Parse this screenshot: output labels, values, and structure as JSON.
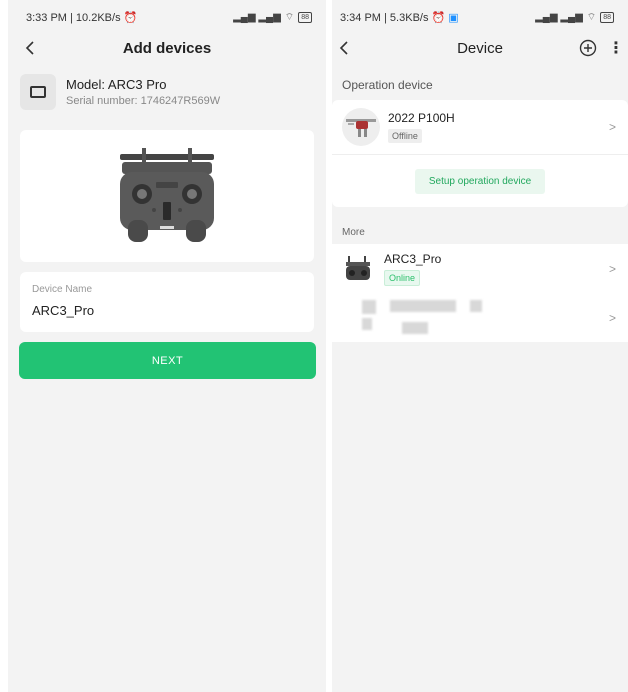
{
  "left": {
    "status": {
      "time_text": "3:33 PM | 10.2KB/s",
      "alarm_icon": "alarm-icon",
      "signal_text": "̶ıl ̶ıl",
      "battery": "88"
    },
    "appbar": {
      "back_icon": "chevron-left-icon",
      "title": "Add devices"
    },
    "model": {
      "icon": "controller-frame-icon",
      "name": "Model: ARC3 Pro",
      "serial": "Serial number: 1746247R569W"
    },
    "image": {
      "icon": "remote-controller-image"
    },
    "device_name": {
      "label": "Device Name",
      "value": "ARC3_Pro"
    },
    "next_label": "NEXT"
  },
  "right": {
    "status": {
      "time_text": "3:34 PM | 5.3KB/s",
      "alarm_icon": "alarm-icon",
      "app_icon": "app-notification-icon",
      "battery": "88"
    },
    "appbar": {
      "back_icon": "chevron-left-icon",
      "title": "Device",
      "add_icon": "plus-circle-icon",
      "more_icon": "more-vertical-icon"
    },
    "operation": {
      "section_label": "Operation device",
      "device": {
        "name": "2022 P100H",
        "status": "Offline",
        "icon": "drone-icon"
      },
      "setup_label": "Setup operation device"
    },
    "more": {
      "section_label": "More",
      "devices": [
        {
          "name": "ARC3_Pro",
          "status": "Online",
          "icon": "remote-controller-icon"
        }
      ]
    }
  },
  "colors": {
    "accent": "#22c374",
    "online": "#2bbf6b",
    "background": "#f3f3f3"
  }
}
